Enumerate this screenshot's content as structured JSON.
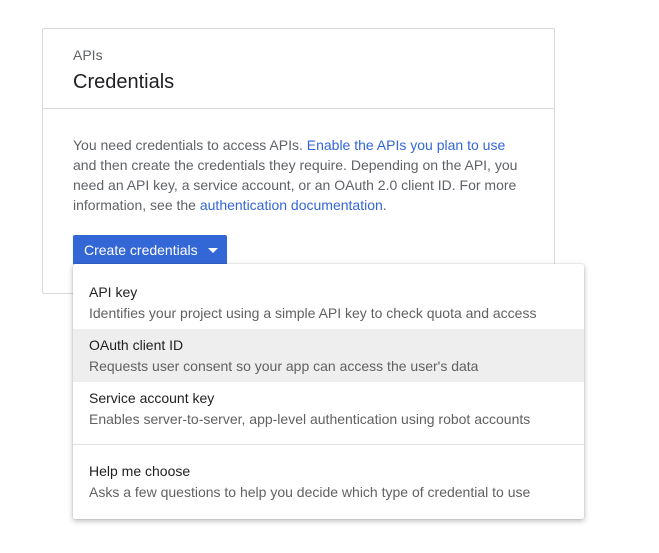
{
  "card": {
    "eyebrow": "APIs",
    "title": "Credentials",
    "description": {
      "part1": "You need credentials to access APIs. ",
      "link1": "Enable the APIs you plan to use",
      "part2": " and then create the credentials they require. Depending on the API, you need an API key, a service account, or an OAuth 2.0 client ID. For more information, see the ",
      "link2": "authentication documentation",
      "part3": "."
    },
    "button_label": "Create credentials"
  },
  "menu": {
    "items": [
      {
        "title": "API key",
        "description": "Identifies your project using a simple API key to check quota and access"
      },
      {
        "title": "OAuth client ID",
        "description": "Requests user consent so your app can access the user's data"
      },
      {
        "title": "Service account key",
        "description": "Enables server-to-server, app-level authentication using robot accounts"
      },
      {
        "title": "Help me choose",
        "description": "Asks a few questions to help you decide which type of credential to use"
      }
    ]
  },
  "colors": {
    "accent": "#3367d6",
    "hover": "#eeeeee"
  },
  "icons": {
    "button_caret": "caret-down-icon"
  }
}
